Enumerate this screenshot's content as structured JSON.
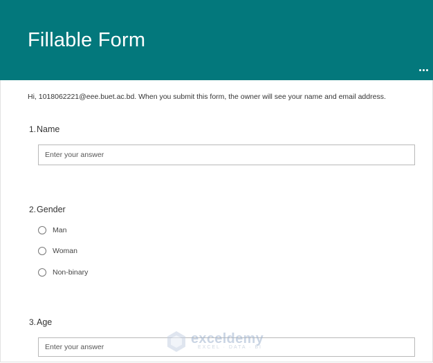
{
  "header": {
    "title": "Fillable Form",
    "background_color": "#03787c",
    "more_icon": "more-horizontal-icon"
  },
  "notice": "Hi, 1018062221@eee.buet.ac.bd. When you submit this form, the owner will see your name and email address.",
  "questions": [
    {
      "number": "1.",
      "label": "Name",
      "type": "text",
      "placeholder": "Enter your answer",
      "value": ""
    },
    {
      "number": "2.",
      "label": "Gender",
      "type": "radio",
      "options": [
        "Man",
        "Woman",
        "Non-binary"
      ],
      "selected": null
    },
    {
      "number": "3.",
      "label": "Age",
      "type": "text",
      "placeholder": "Enter your answer",
      "value": ""
    }
  ],
  "watermark": {
    "brand": "exceldemy",
    "tagline": "EXCEL · DATA · BI"
  }
}
